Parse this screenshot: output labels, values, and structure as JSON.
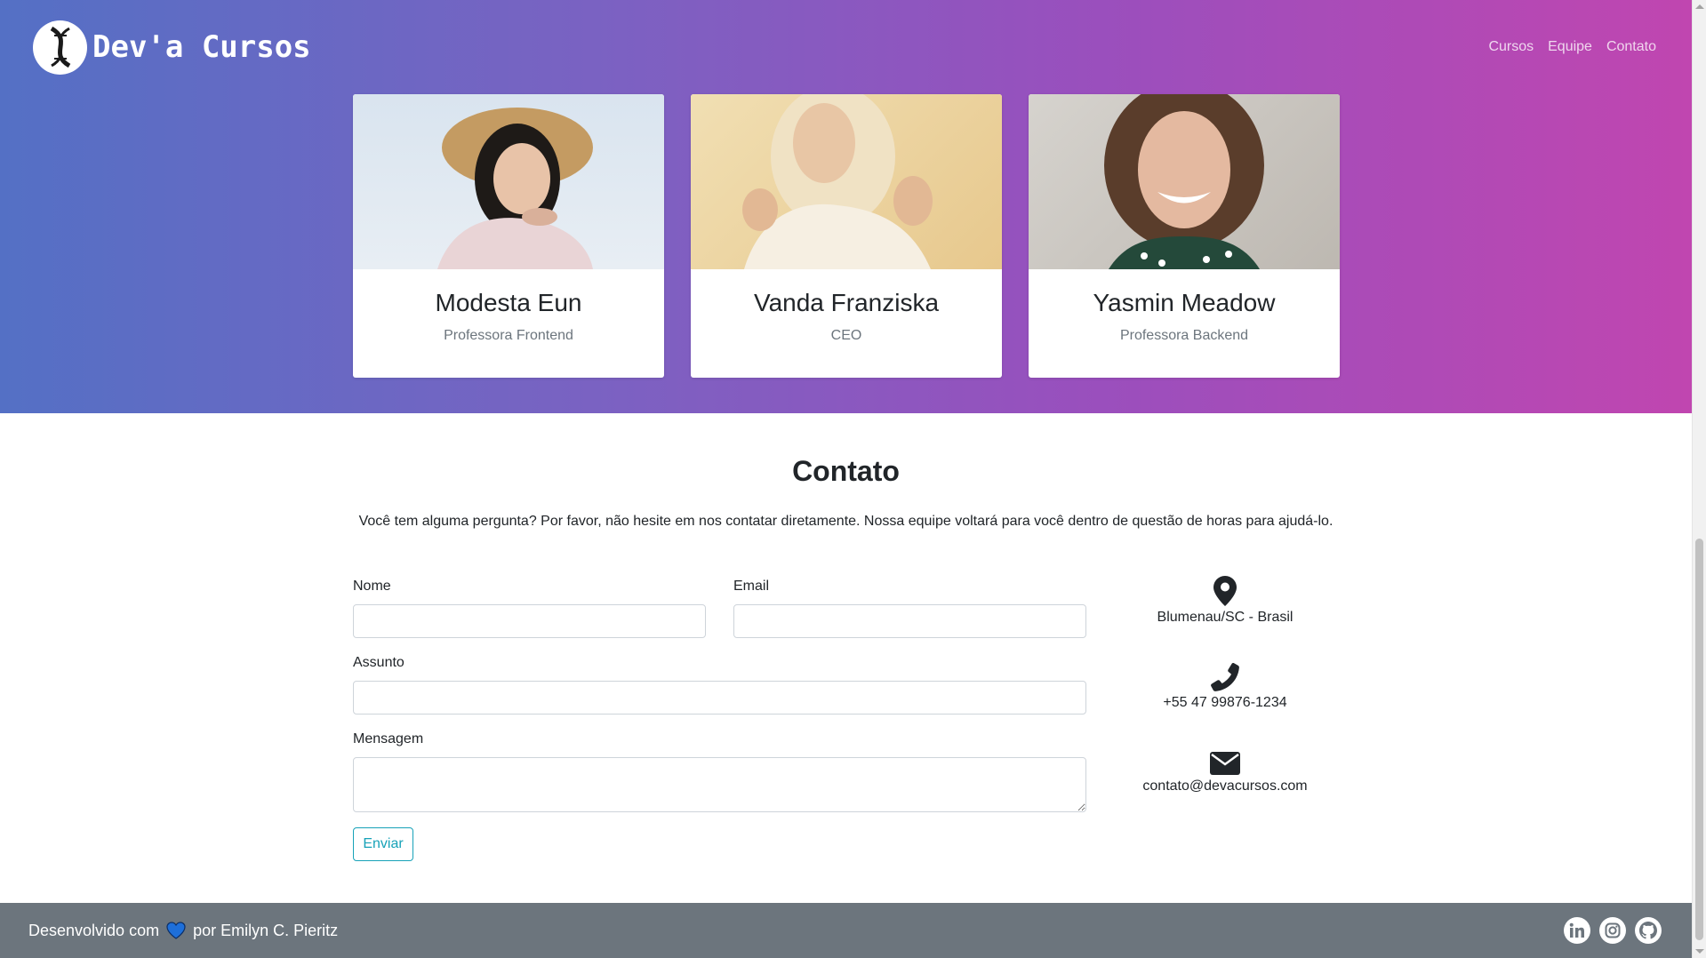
{
  "brand": {
    "name": "Dev'a Cursos"
  },
  "nav": {
    "items": [
      "Cursos",
      "Equipe",
      "Contato"
    ]
  },
  "team": [
    {
      "name": "Modesta Eun",
      "role": "Professora Frontend"
    },
    {
      "name": "Vanda Franziska",
      "role": "CEO"
    },
    {
      "name": "Yasmin Meadow",
      "role": "Professora Backend"
    }
  ],
  "contact": {
    "title": "Contato",
    "lead": "Você tem alguma pergunta? Por favor, não hesite em nos contatar diretamente. Nossa equipe voltará para você dentro de questão de horas para ajudá-lo.",
    "labels": {
      "name": "Nome",
      "email": "Email",
      "subject": "Assunto",
      "message": "Mensagem"
    },
    "submit_label": "Enviar",
    "info": {
      "location": "Blumenau/SC - Brasil",
      "phone": "+55 47 99876-1234",
      "email": "contato@devacursos.com"
    }
  },
  "footer": {
    "credit_prefix": "Desenvolvido com",
    "credit_suffix": "por Emilyn C. Pieritz",
    "socials": [
      "linkedin-icon",
      "instagram-icon",
      "github-icon"
    ]
  },
  "colors": {
    "gradient_start": "#5470c5",
    "gradient_end": "#c046b0",
    "footer_bg": "#6c757d",
    "button_accent": "#17a2b8",
    "heart": "#1e6fd9"
  }
}
